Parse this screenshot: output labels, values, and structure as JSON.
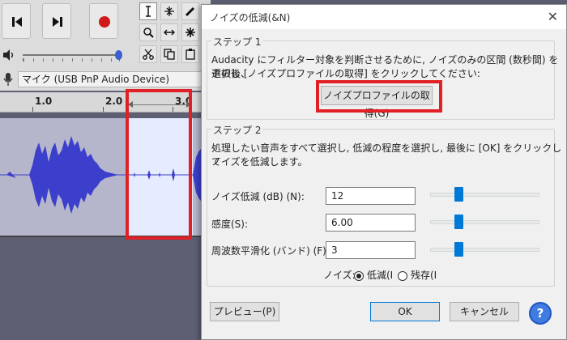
{
  "device": {
    "label": "マイク (USB PnP Audio Device)"
  },
  "ruler": {
    "ticks": [
      "1.0",
      "2.0",
      "3.0"
    ]
  },
  "dialog": {
    "title": "ノイズの低減(&N)",
    "step1": {
      "title": "ステップ 1",
      "text_line1": "Audacity にフィルター対象を判断させるために, ノイズのみの区間 (数秒間) を選択し、",
      "text_line2": "その後 [ノイズプロファイルの取得] をクリックしてください:",
      "button": "ノイズプロファイルの取得(G)"
    },
    "step2": {
      "title": "ステップ 2",
      "text_line1": "処理したい音声をすべて選択し, 低減の程度を選択し, 最後に [OK] をクリックして",
      "text_line2": "ノイズを低減します。",
      "noise_reduction": {
        "label": "ノイズ低減 (dB) (N):",
        "value": "12",
        "slider": 0.27
      },
      "sensitivity": {
        "label": "感度(S):",
        "value": "6.00",
        "slider": 0.27
      },
      "freq_smoothing": {
        "label": "周波数平滑化 (バンド) (F):",
        "value": "3",
        "slider": 0.27
      },
      "noise_label": "ノイズ:",
      "option_reduce": "低減(I",
      "option_residue": "残存(I"
    },
    "buttons": {
      "preview": "プレビュー(P)",
      "ok": "OK",
      "cancel": "キャンセル",
      "help": "?"
    }
  },
  "colors": {
    "waveform": "#3b3fcc",
    "highlight": "#e02025",
    "accent": "#0078d7"
  }
}
